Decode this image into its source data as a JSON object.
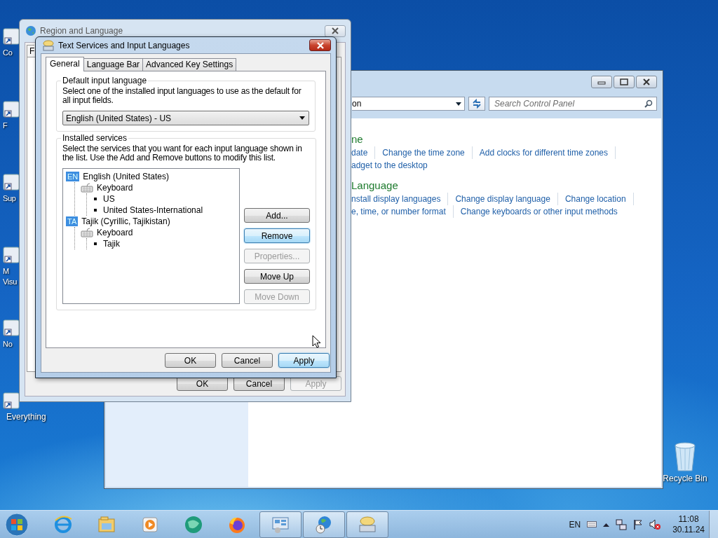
{
  "desktop_icons": [
    {
      "label_lines": [
        "Co"
      ]
    },
    {
      "label_lines": [
        "F"
      ]
    },
    {
      "label_lines": [
        "Sup"
      ]
    },
    {
      "label_lines": [
        "M",
        "Visu"
      ]
    },
    {
      "label_lines": [
        "No"
      ]
    },
    {
      "label_lines": [
        "Everything"
      ]
    }
  ],
  "recycle_bin": {
    "label": "Recycle Bin"
  },
  "control_panel": {
    "address": "on",
    "search": {
      "placeholder": "Search Control Panel"
    },
    "sections": [
      {
        "heading": "ne",
        "link_rows": [
          [
            "date",
            "Change the time zone",
            "Add clocks for different time zones"
          ],
          [
            "adget to the desktop"
          ]
        ]
      },
      {
        "heading": "Language",
        "link_rows": [
          [
            "nstall display languages",
            "Change display language",
            "Change location"
          ],
          [
            "e, time, or number format",
            "Change keyboards or other input methods"
          ]
        ]
      }
    ]
  },
  "region_window": {
    "title": "Region and Language",
    "tab": "F",
    "buttons": [
      {
        "label": "OK",
        "disabled": false
      },
      {
        "label": "Cancel",
        "disabled": false
      },
      {
        "label": "Apply",
        "disabled": true
      }
    ]
  },
  "dialog": {
    "title": "Text Services and Input Languages",
    "tabs": [
      {
        "label": "General",
        "selected": true
      },
      {
        "label": "Language Bar",
        "selected": false
      },
      {
        "label": "Advanced Key Settings",
        "selected": false
      }
    ],
    "default_group": {
      "title": "Default input language",
      "description": "Select one of the installed input languages to use as the default for all input fields.",
      "selected_language": "English (United States) - US"
    },
    "services_group": {
      "title": "Installed services",
      "description": "Select the services that you want for each input language shown in the list. Use the Add and Remove buttons to modify this list.",
      "tree": [
        {
          "kind": "language",
          "badge": "EN",
          "text": "English (United States)",
          "children": [
            {
              "kind": "category",
              "text": "Keyboard",
              "children": [
                {
                  "kind": "layout",
                  "text": "US"
                },
                {
                  "kind": "layout",
                  "text": "United States-International"
                }
              ]
            }
          ]
        },
        {
          "kind": "language",
          "badge": "TA",
          "text": "Tajik (Cyrillic, Tajikistan)",
          "children": [
            {
              "kind": "category",
              "text": "Keyboard",
              "children": [
                {
                  "kind": "layout",
                  "text": "Tajik"
                }
              ]
            }
          ]
        }
      ],
      "buttons": [
        {
          "label": "Add...",
          "disabled": false,
          "highlighted": false
        },
        {
          "label": "Remove",
          "disabled": false,
          "highlighted": true
        },
        {
          "label": "Properties...",
          "disabled": true,
          "highlighted": false
        },
        {
          "label": "Move Up",
          "disabled": false,
          "highlighted": false
        },
        {
          "label": "Move Down",
          "disabled": true,
          "highlighted": false
        }
      ]
    },
    "buttons": [
      {
        "label": "OK",
        "disabled": false,
        "highlighted": false
      },
      {
        "label": "Cancel",
        "disabled": false,
        "highlighted": false
      },
      {
        "label": "Apply",
        "disabled": false,
        "highlighted": true
      }
    ]
  },
  "taskbar": {
    "apps": [
      {
        "kind": "browser",
        "active": false
      },
      {
        "kind": "folder",
        "active": false
      },
      {
        "kind": "media",
        "active": false
      },
      {
        "kind": "orb",
        "active": false
      },
      {
        "kind": "fox",
        "active": false
      },
      {
        "kind": "panel",
        "active": true
      },
      {
        "kind": "globe",
        "active": true
      },
      {
        "kind": "keyboard",
        "active": true
      }
    ],
    "language": "EN",
    "time": "11:08",
    "date": "30.11.24"
  }
}
